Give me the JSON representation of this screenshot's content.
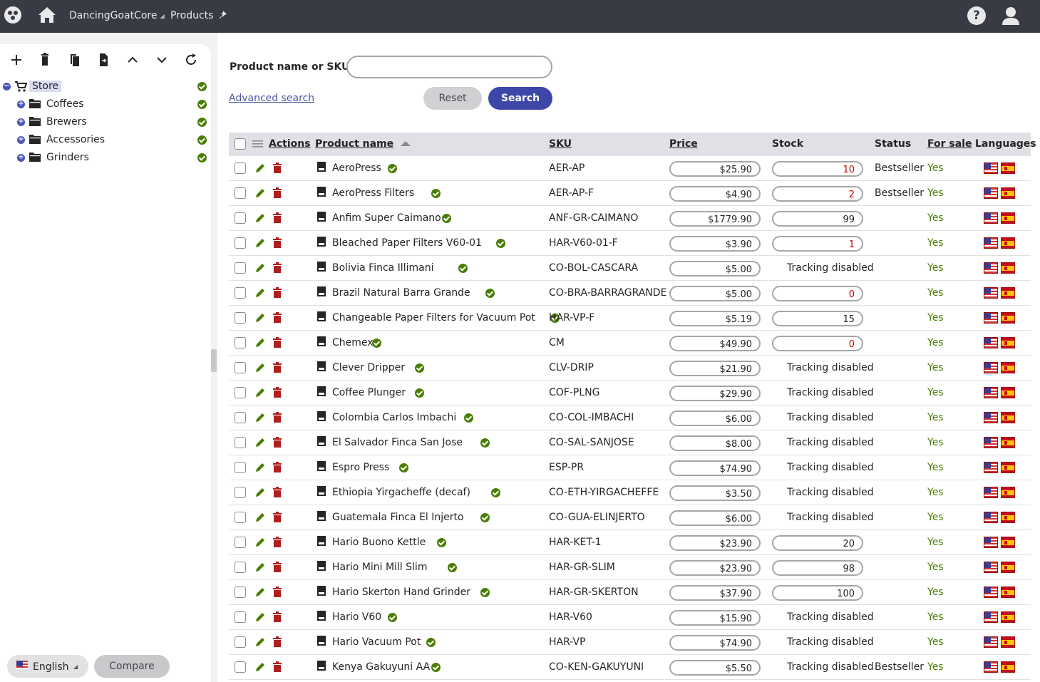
{
  "header": {
    "site_name": "DancingGoatCore",
    "app_name": "Products",
    "icons": [
      "app-logo-icon",
      "home-icon",
      "pin-icon",
      "help-icon",
      "user-icon"
    ]
  },
  "tree": {
    "toolbar_icons": [
      "plus-icon",
      "trash-icon",
      "copy-icon",
      "move-icon",
      "chevron-up-icon",
      "chevron-down-icon",
      "refresh-icon"
    ],
    "root": {
      "label": "Store"
    },
    "children": [
      {
        "label": "Coffees"
      },
      {
        "label": "Brewers"
      },
      {
        "label": "Accessories"
      },
      {
        "label": "Grinders"
      }
    ]
  },
  "footer": {
    "language": "English",
    "compare": "Compare"
  },
  "filter": {
    "label": "Product name or SKU:",
    "value": "",
    "advanced": "Advanced search",
    "reset": "Reset",
    "search": "Search"
  },
  "grid": {
    "columns": {
      "actions": "Actions",
      "name": "Product name",
      "sku": "SKU",
      "price": "Price",
      "stock": "Stock",
      "status": "Status",
      "for_sale": "For sale",
      "languages": "Languages"
    },
    "rows": [
      {
        "name": "AeroPress",
        "sku": "AER-AP",
        "price": "$25.90",
        "stock": "10",
        "stock_low": true,
        "status": "Bestseller",
        "for_sale": "Yes"
      },
      {
        "name": "AeroPress Filters",
        "sku": "AER-AP-F",
        "price": "$4.90",
        "stock": "2",
        "stock_low": true,
        "status": "Bestseller",
        "for_sale": "Yes"
      },
      {
        "name": "Anfim Super Caimano",
        "sku": "ANF-GR-CAIMANO",
        "price": "$1779.90",
        "stock": "99",
        "stock_low": false,
        "status": "",
        "for_sale": "Yes"
      },
      {
        "name": "Bleached Paper Filters V60-01",
        "sku": "HAR-V60-01-F",
        "price": "$3.90",
        "stock": "1",
        "stock_low": true,
        "status": "",
        "for_sale": "Yes"
      },
      {
        "name": "Bolivia Finca Illimani",
        "sku": "CO-BOL-CASCARA",
        "price": "$5.00",
        "stock_text": "Tracking disabled",
        "status": "",
        "for_sale": "Yes"
      },
      {
        "name": "Brazil Natural Barra Grande",
        "sku": "CO-BRA-BARRAGRANDE",
        "price": "$5.00",
        "stock": "0",
        "stock_low": true,
        "status": "",
        "for_sale": "Yes"
      },
      {
        "name": "Changeable Paper Filters for Vacuum Pot",
        "sku": "HAR-VP-F",
        "price": "$5.19",
        "stock": "15",
        "stock_low": false,
        "status": "",
        "for_sale": "Yes"
      },
      {
        "name": "Chemex",
        "sku": "CM",
        "price": "$49.90",
        "stock": "0",
        "stock_low": true,
        "status": "",
        "for_sale": "Yes"
      },
      {
        "name": "Clever Dripper",
        "sku": "CLV-DRIP",
        "price": "$21.90",
        "stock_text": "Tracking disabled",
        "status": "",
        "for_sale": "Yes"
      },
      {
        "name": "Coffee Plunger",
        "sku": "COF-PLNG",
        "price": "$29.90",
        "stock_text": "Tracking disabled",
        "status": "",
        "for_sale": "Yes"
      },
      {
        "name": "Colombia Carlos Imbachi",
        "sku": "CO-COL-IMBACHI",
        "price": "$6.00",
        "stock_text": "Tracking disabled",
        "status": "",
        "for_sale": "Yes"
      },
      {
        "name": "El Salvador Finca San Jose",
        "sku": "CO-SAL-SANJOSE",
        "price": "$8.00",
        "stock_text": "Tracking disabled",
        "status": "",
        "for_sale": "Yes"
      },
      {
        "name": "Espro Press",
        "sku": "ESP-PR",
        "price": "$74.90",
        "stock_text": "Tracking disabled",
        "status": "",
        "for_sale": "Yes"
      },
      {
        "name": "Ethiopia Yirgacheffe (decaf)",
        "sku": "CO-ETH-YIRGACHEFFE",
        "price": "$3.50",
        "stock_text": "Tracking disabled",
        "status": "",
        "for_sale": "Yes"
      },
      {
        "name": "Guatemala Finca El Injerto",
        "sku": "CO-GUA-ELINJERTO",
        "price": "$6.00",
        "stock_text": "Tracking disabled",
        "status": "",
        "for_sale": "Yes"
      },
      {
        "name": "Hario Buono Kettle",
        "sku": "HAR-KET-1",
        "price": "$23.90",
        "stock": "20",
        "stock_low": false,
        "status": "",
        "for_sale": "Yes"
      },
      {
        "name": "Hario Mini Mill Slim",
        "sku": "HAR-GR-SLIM",
        "price": "$23.90",
        "stock": "98",
        "stock_low": false,
        "status": "",
        "for_sale": "Yes"
      },
      {
        "name": "Hario Skerton Hand Grinder",
        "sku": "HAR-GR-SKERTON",
        "price": "$37.90",
        "stock": "100",
        "stock_low": false,
        "status": "",
        "for_sale": "Yes"
      },
      {
        "name": "Hario V60",
        "sku": "HAR-V60",
        "price": "$15.90",
        "stock_text": "Tracking disabled",
        "status": "",
        "for_sale": "Yes"
      },
      {
        "name": "Hario Vacuum Pot",
        "sku": "HAR-VP",
        "price": "$74.90",
        "stock_text": "Tracking disabled",
        "status": "",
        "for_sale": "Yes"
      },
      {
        "name": "Kenya Gakuyuni AA",
        "sku": "CO-KEN-GAKUYUNI",
        "price": "$5.50",
        "stock_text": "Tracking disabled",
        "status": "Bestseller",
        "for_sale": "Yes"
      }
    ]
  },
  "colors": {
    "topbar": "#383a44",
    "primary": "#3d47a8",
    "success": "#497d04",
    "danger": "#b01e1e",
    "low_stock": "#cc0000"
  }
}
